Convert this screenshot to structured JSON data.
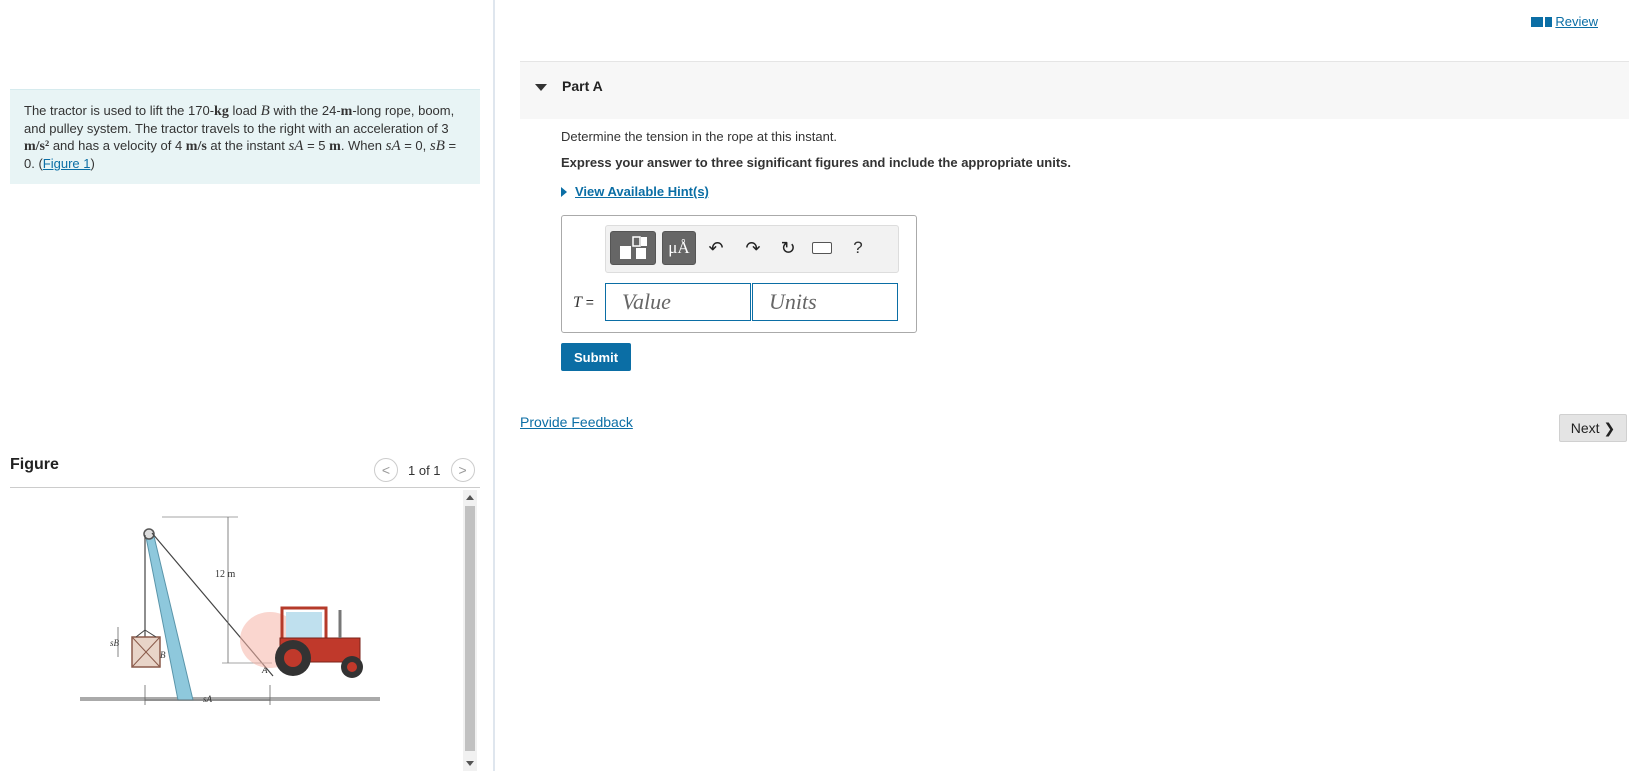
{
  "problem": {
    "p1": "The tractor is used to lift the 170-",
    "kg": "kg",
    "p2": " load ",
    "B": "B",
    "p3": " with the 24-",
    "m": "m",
    "p4": "-long rope, boom, and pulley system. The tractor travels to the right with an acceleration of 3 ",
    "accel_unit": "m/s²",
    "p5": " and has a velocity of 4 ",
    "vel_unit": "m/s",
    "p6": " at the instant ",
    "sA": "sA",
    "p7": " = 5 ",
    "p8": ". When ",
    "p9": " = 0, ",
    "sB": "sB",
    "p10": " = 0. (",
    "figure_link": "Figure 1",
    "p11": ")"
  },
  "figure": {
    "title": "Figure",
    "pager": "1 of 1",
    "prev": "<",
    "next": ">",
    "dim_label": "12 m",
    "label_sB": "sB",
    "label_sA": "sA",
    "label_B": "B",
    "label_A": "A"
  },
  "review": {
    "label": "Review"
  },
  "part": {
    "label": "Part A"
  },
  "question": {
    "prompt": "Determine the tension in the rope at this instant.",
    "instruction": "Express your answer to three significant figures and include the appropriate units.",
    "hint": "View Available Hint(s)"
  },
  "answer": {
    "var": "T",
    "eq": " =",
    "value_placeholder": "Value",
    "units_placeholder": "Units"
  },
  "toolbar": {
    "mu_label": "μÅ",
    "undo": "↶",
    "redo": "↷",
    "reset": "↻",
    "help": "?"
  },
  "buttons": {
    "submit": "Submit",
    "feedback": "Provide Feedback",
    "next": "Next"
  },
  "colors": {
    "accent": "#0b6ea5",
    "problem_bg": "#e8f4f5",
    "boom": "#8ec8dc",
    "tractor": "#c0392b"
  }
}
